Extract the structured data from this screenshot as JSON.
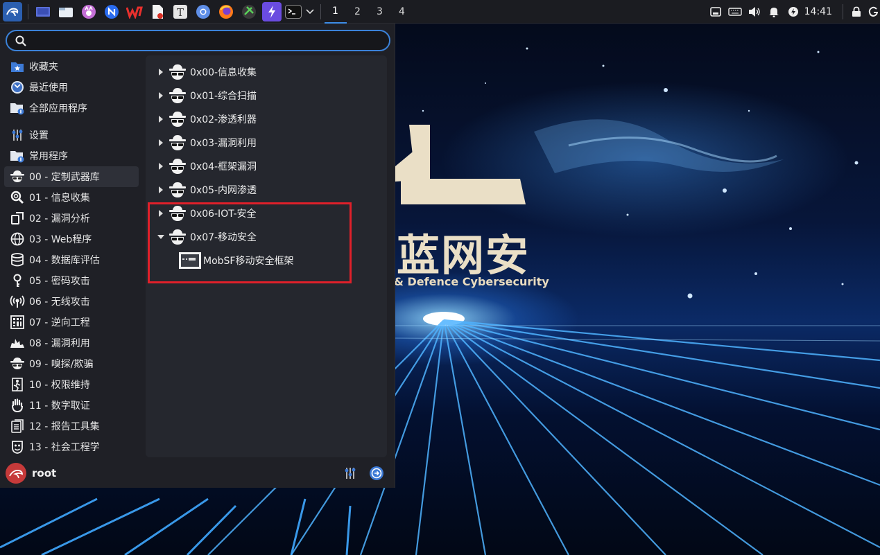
{
  "taskbar": {
    "workspaces": [
      "1",
      "2",
      "3",
      "4"
    ],
    "active_workspace": "1",
    "clock": "14:41",
    "apps": [
      "kali-menu-icon",
      "desktop-icon",
      "file-manager-icon",
      "cat-app-icon",
      "browser-n-icon",
      "wps-icon",
      "document-app-icon",
      "typora-icon",
      "chromium-icon",
      "firefox-icon",
      "tool-app-icon",
      "bolt-app-icon",
      "terminal-icon"
    ],
    "tray": [
      "network-icon",
      "keyboard-icon",
      "volume-icon",
      "notification-icon",
      "power-icon",
      "lock-icon"
    ]
  },
  "search": {
    "value": "",
    "placeholder": ""
  },
  "categories": [
    {
      "label": "收藏夹",
      "icon": "star-folder-icon"
    },
    {
      "label": "最近使用",
      "icon": "recent-icon"
    },
    {
      "label": "全部应用程序",
      "icon": "all-apps-icon"
    },
    {
      "label": "设置",
      "icon": "settings-icon"
    },
    {
      "label": "常用程序",
      "icon": "common-apps-icon"
    },
    {
      "label": "00 - 定制武器库",
      "icon": "spy-icon"
    },
    {
      "label": "01 - 信息收集",
      "icon": "magnifier-icon"
    },
    {
      "label": "02 - 漏洞分析",
      "icon": "vuln-icon"
    },
    {
      "label": "03 - Web程序",
      "icon": "globe-icon"
    },
    {
      "label": "04 - 数据库评估",
      "icon": "database-icon"
    },
    {
      "label": "05 - 密码攻击",
      "icon": "key-icon"
    },
    {
      "label": "06 - 无线攻击",
      "icon": "wireless-icon"
    },
    {
      "label": "07 - 逆向工程",
      "icon": "reverse-icon"
    },
    {
      "label": "08 - 漏洞利用",
      "icon": "exploit-icon"
    },
    {
      "label": "09 - 嗅探/欺骗",
      "icon": "sniff-icon"
    },
    {
      "label": "10 - 权限维持",
      "icon": "persistence-icon"
    },
    {
      "label": "11 - 数字取证",
      "icon": "hand-icon"
    },
    {
      "label": "12 - 报告工具集",
      "icon": "report-icon"
    },
    {
      "label": "13 - 社会工程学",
      "icon": "social-icon"
    }
  ],
  "selected_category": "00 - 定制武器库",
  "apps": [
    {
      "label": "0x00-信息收集",
      "expanded": false
    },
    {
      "label": "0x01-综合扫描",
      "expanded": false
    },
    {
      "label": "0x02-渗透利器",
      "expanded": false
    },
    {
      "label": "0x03-漏洞利用",
      "expanded": false
    },
    {
      "label": "0x04-框架漏洞",
      "expanded": false
    },
    {
      "label": "0x05-内网渗透",
      "expanded": false
    },
    {
      "label": "0x06-IOT-安全",
      "expanded": false
    },
    {
      "label": "0x07-移动安全",
      "expanded": true
    }
  ],
  "sub_items": [
    {
      "label": "MobSF移动安全框架",
      "icon": "mobsf-icon"
    }
  ],
  "footer": {
    "user": "root"
  },
  "wallpaper": {
    "brand_big": "蓝网安",
    "brand_sub": "& Defence Cybersecurity"
  },
  "colors": {
    "accent": "#3b82d9",
    "highlight_box": "#e0202a",
    "menu_bg": "#1f2026",
    "panel_bg": "#1b1c21"
  }
}
